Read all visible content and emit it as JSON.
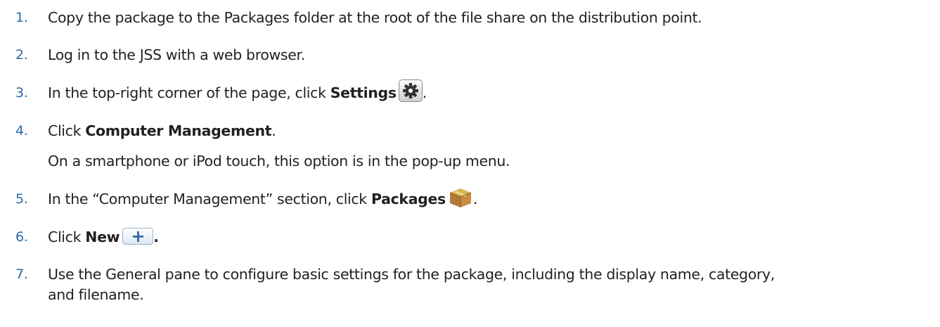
{
  "steps": [
    {
      "number": "1.",
      "text": "Copy the package to the Packages folder at the root of the file share on the distribution point."
    },
    {
      "number": "2.",
      "text": "Log in to the JSS with a web browser."
    },
    {
      "number": "3.",
      "prefix": "In the top-right corner of the page, click ",
      "bold": "Settings",
      "icon": "gear-icon",
      "suffix": "."
    },
    {
      "number": "4.",
      "prefix": "Click ",
      "bold": "Computer Management",
      "suffix": ".",
      "note": "On a smartphone or iPod touch, this option is in the pop-up menu."
    },
    {
      "number": "5.",
      "prefix": "In the “Computer Management” section, click ",
      "bold": "Packages",
      "icon": "package-box-icon",
      "suffix": "."
    },
    {
      "number": "6.",
      "prefix": "Click ",
      "bold": "New",
      "icon": "plus-icon",
      "button_symbol": "+",
      "suffix": "."
    },
    {
      "number": "7.",
      "text": "Use the General pane to configure basic settings for the package, including the display name, category,",
      "continuation": "and filename."
    }
  ],
  "colors": {
    "step_number": "#2e6aa5",
    "body_text": "#231f20",
    "accent_button": "#2e6aa5"
  }
}
